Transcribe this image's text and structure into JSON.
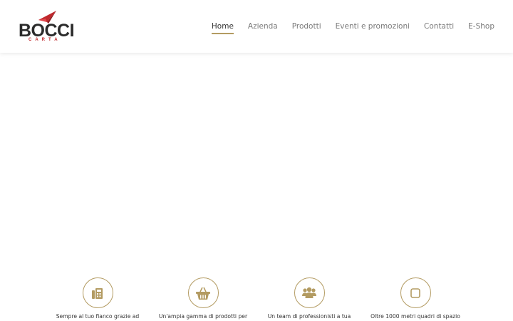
{
  "brand": {
    "name": "BOCCI",
    "sub": "CARTA",
    "colors": {
      "dark": "#2b2b2b",
      "red": "#c0282d",
      "accent": "#b39b62"
    }
  },
  "nav": {
    "items": [
      {
        "label": "Home",
        "active": true
      },
      {
        "label": "Azienda",
        "active": false
      },
      {
        "label": "Prodotti",
        "active": false
      },
      {
        "label": "Eventi e promozioni",
        "active": false
      },
      {
        "label": "Contatti",
        "active": false
      },
      {
        "label": "E-Shop",
        "active": false
      }
    ]
  },
  "features": [
    {
      "icon": "fax-icon",
      "text": "Sempre al tuo fianco grazie ad"
    },
    {
      "icon": "basket-icon",
      "text": "Un'ampia gamma di prodotti per"
    },
    {
      "icon": "team-icon",
      "text": "Un team di professionisti a tua"
    },
    {
      "icon": "square-icon",
      "text": "Oltre 1000 metri quadri di spazio"
    }
  ]
}
